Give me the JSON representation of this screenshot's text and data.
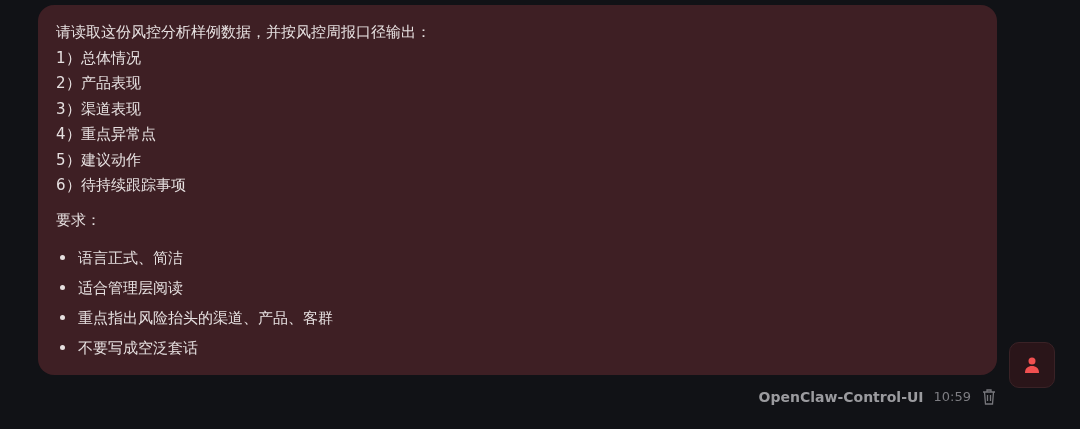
{
  "message": {
    "intro": "请读取这份风控分析样例数据，并按风控周报口径输出：",
    "sections": [
      "1）总体情况",
      "2）产品表现",
      "3）渠道表现",
      "4）重点异常点",
      "5）建议动作",
      "6）待持续跟踪事项"
    ],
    "requirements_heading": "要求：",
    "requirements": [
      "语言正式、简洁",
      "适合管理层阅读",
      "重点指出风险抬头的渠道、产品、客群",
      "不要写成空泛套话"
    ]
  },
  "footer": {
    "sender": "OpenClaw-Control-UI",
    "time": "10:59"
  }
}
